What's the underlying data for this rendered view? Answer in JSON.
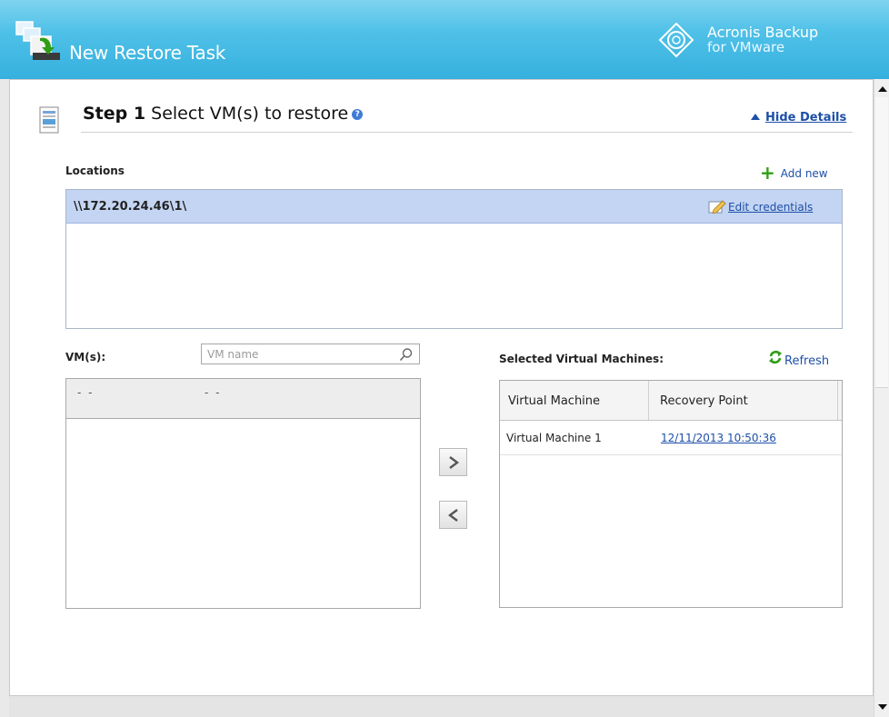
{
  "window": {
    "title": "New Restore Task",
    "brand_line1": "Acronis Backup",
    "brand_line2": "for VMware"
  },
  "step": {
    "number_label": "Step 1",
    "title": "Select VM(s) to restore",
    "hide_details": "Hide Details"
  },
  "locations": {
    "label": "Locations",
    "add_new": "Add new",
    "items": [
      {
        "path": "\\\\172.20.24.46\\1\\",
        "edit_label": "Edit credentials"
      }
    ]
  },
  "vms": {
    "label": "VM(s):",
    "search_placeholder": "VM name",
    "header_col1": "- -",
    "header_col2": "- -"
  },
  "selected": {
    "label": "Selected Virtual Machines:",
    "refresh": "Refresh",
    "columns": [
      "Virtual Machine",
      "Recovery Point"
    ],
    "rows": [
      {
        "vm": "Virtual Machine 1",
        "recovery_point": "12/11/2013 10:50:36"
      }
    ]
  },
  "icons": {
    "app": "restore-task-icon",
    "brand": "acronis-logo-icon",
    "step": "document-icon",
    "help": "help-icon",
    "add": "plus-icon",
    "edit": "pencil-icon",
    "search": "search-icon",
    "refresh": "refresh-icon",
    "add_arrow": "chevron-right-icon",
    "remove_arrow": "chevron-left-icon"
  },
  "colors": {
    "title_bar": "#36b0de",
    "link": "#1d4fa8",
    "selected_row": "#c4d5f3",
    "add_green": "#2f9e15"
  }
}
